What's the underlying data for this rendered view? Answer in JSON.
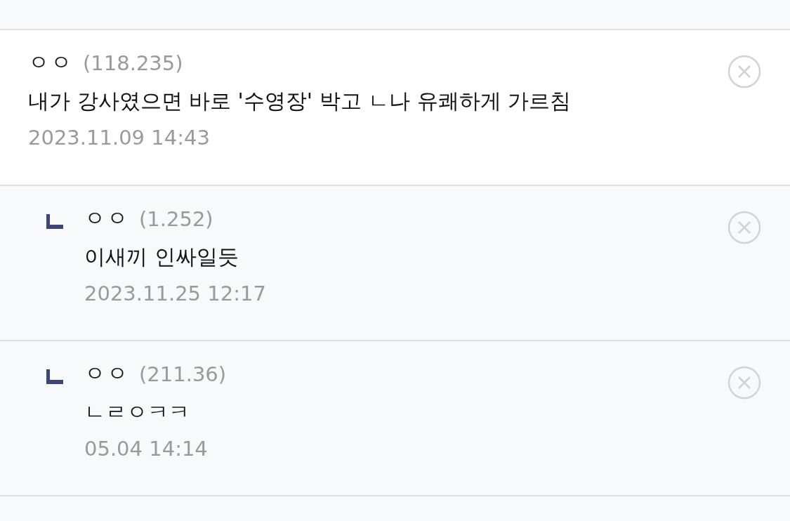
{
  "comments": [
    {
      "author": "ㅇㅇ",
      "ip": "(118.235)",
      "text": "내가 강사였으면 바로 '수영장' 박고 ㄴ나 유쾌하게 가르침",
      "date": "2023.11.09 14:43",
      "children": [
        {
          "author": "ㅇㅇ",
          "ip": "(1.252)",
          "text": "이새끼 인싸일듯",
          "date": "2023.11.25 12:17"
        },
        {
          "author": "ㅇㅇ",
          "ip": "(211.36)",
          "text": "ㄴㄹㅇㅋㅋ",
          "date": "05.04 14:14"
        }
      ]
    }
  ]
}
